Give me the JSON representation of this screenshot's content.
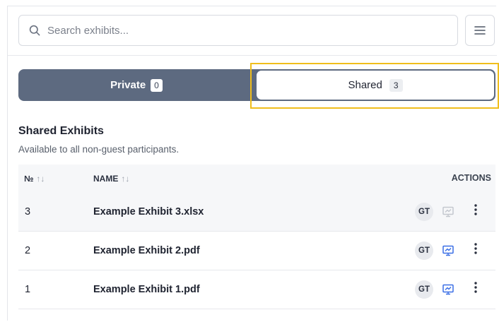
{
  "search": {
    "placeholder": "Search exhibits..."
  },
  "tabs": {
    "private": {
      "label": "Private",
      "count": "0"
    },
    "shared": {
      "label": "Shared",
      "count": "3"
    }
  },
  "section": {
    "title": "Shared Exhibits",
    "subtitle": "Available to all non-guest participants."
  },
  "table": {
    "headers": {
      "number": "№",
      "name": "NAME",
      "actions": "ACTIONS",
      "sort_glyph": "↑↓"
    },
    "rows": [
      {
        "number": "3",
        "name": "Example Exhibit 3.xlsx",
        "owner": "GT",
        "present_enabled": false
      },
      {
        "number": "2",
        "name": "Example Exhibit 2.pdf",
        "owner": "GT",
        "present_enabled": true
      },
      {
        "number": "1",
        "name": "Example Exhibit 1.pdf",
        "owner": "GT",
        "present_enabled": true
      }
    ]
  },
  "icons": {
    "search": "search-icon",
    "menu": "hamburger-menu-icon",
    "present": "presentation-icon",
    "more": "more-vertical-icon"
  },
  "colors": {
    "toggle_bg": "#5d6a80",
    "highlight": "#f0be1c",
    "present_active": "#3a6fe6",
    "present_disabled": "#c4c8cf"
  }
}
